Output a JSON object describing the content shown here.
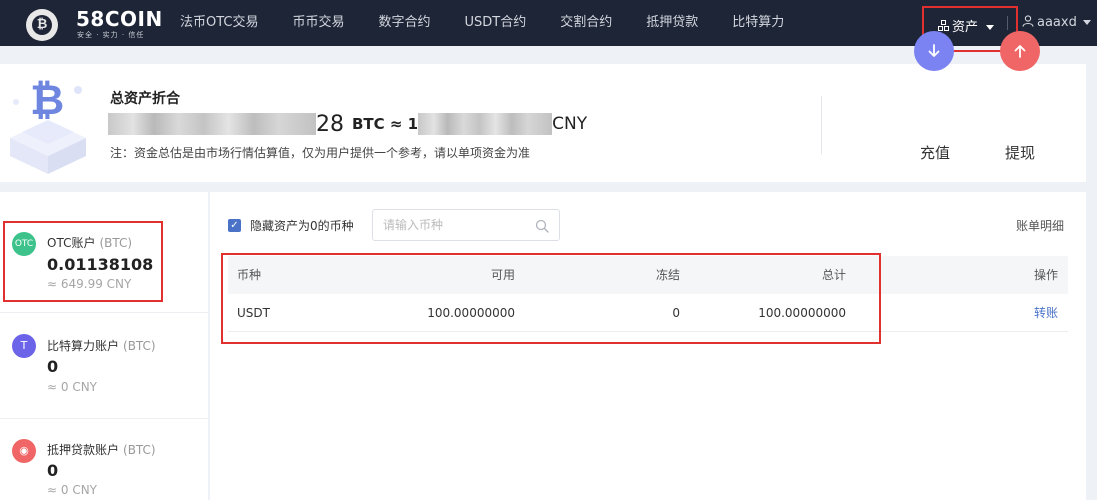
{
  "nav": {
    "logo_name": "58COIN",
    "logo_tagline": "安全 · 实力 · 信任",
    "links": [
      "法币OTC交易",
      "币币交易",
      "数字合约",
      "USDT合约",
      "交割合约",
      "抵押贷款",
      "比特算力"
    ],
    "asset_label": "资产",
    "user_name": "aaaxd"
  },
  "summary": {
    "title": "总资产折合",
    "btc_visible": "28",
    "btc_unit": "BTC ≈ 1",
    "cny_unit": "CNY",
    "note": "注：资金总估是由市场行情估算值，仅为用户提供一个参考，请以单项资金为准",
    "deposit_label": "充值",
    "withdraw_label": "提现"
  },
  "accounts": [
    {
      "icon_text": "OTC",
      "name": "OTC账户",
      "unit": "(BTC)",
      "value": "0.01138108",
      "cny": "≈ 649.99 CNY",
      "color": "#3cc28a"
    },
    {
      "icon_text": "T",
      "name": "比特算力账户",
      "unit": "(BTC)",
      "value": "0",
      "cny": "≈ 0 CNY",
      "color": "#6b63e8"
    },
    {
      "icon_text": "◉",
      "name": "抵押贷款账户",
      "unit": "(BTC)",
      "value": "0",
      "cny": "≈ 0 CNY",
      "color": "#f06565"
    }
  ],
  "filter": {
    "hide_zero_label": "隐藏资产为0的币种",
    "search_placeholder": "请输入币种",
    "bill_detail": "账单明细"
  },
  "table": {
    "headers": {
      "coin": "币种",
      "available": "可用",
      "frozen": "冻结",
      "total": "总计",
      "op": "操作"
    },
    "rows": [
      {
        "coin": "USDT",
        "available": "100.00000000",
        "frozen": "0",
        "total": "100.00000000",
        "op": "转账"
      }
    ]
  }
}
